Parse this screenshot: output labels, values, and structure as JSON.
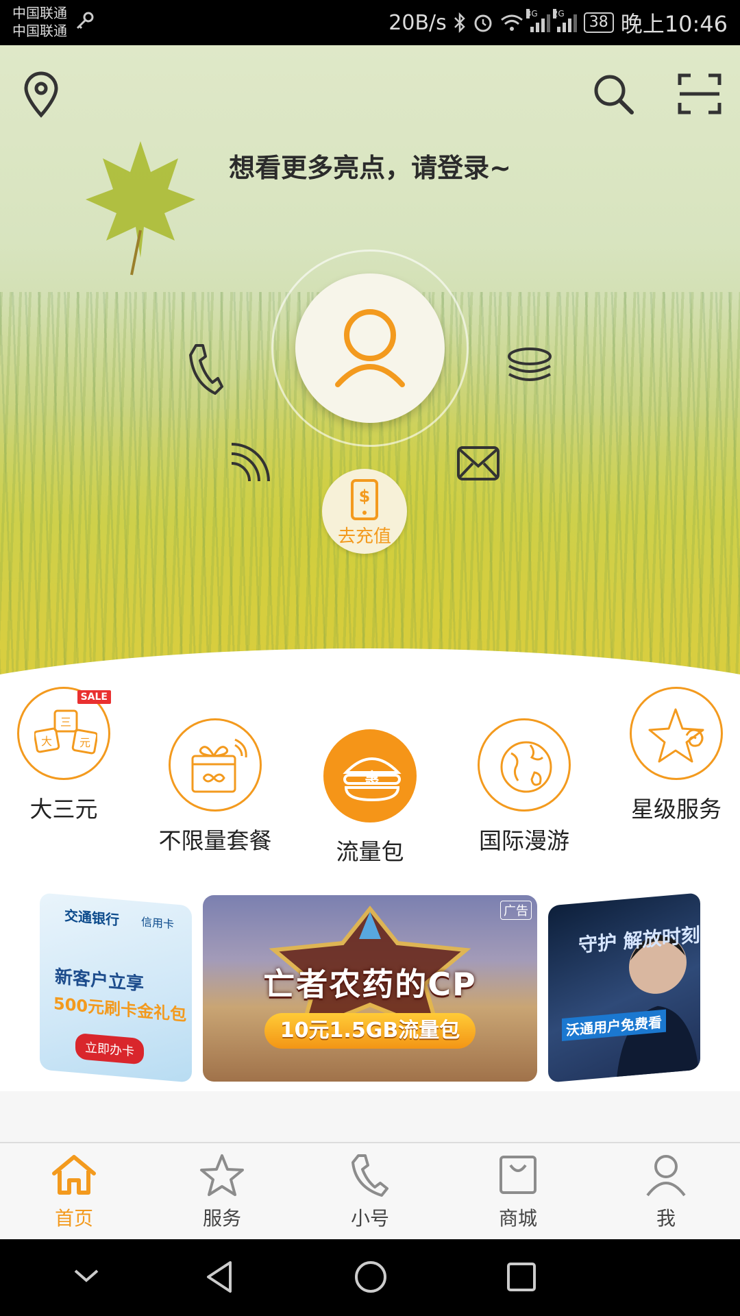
{
  "status_bar": {
    "carrier_1": "中国联通",
    "carrier_2": "中国联通",
    "net_speed": "20B/s",
    "battery": "38",
    "time": "晚上10:46",
    "signal_1_tag": "3G",
    "signal_2_tag": "2G"
  },
  "hero": {
    "login_prompt": "想看更多亮点，请登录~",
    "recharge_label": "去充值"
  },
  "shortcuts": [
    {
      "label": "大三元",
      "badge": "SALE",
      "icon": "dice-icon"
    },
    {
      "label": "不限量套餐",
      "icon": "gift-infinity-icon"
    },
    {
      "label": "流量包",
      "icon": "hui-burger-icon"
    },
    {
      "label": "国际漫游",
      "icon": "globe-icon"
    },
    {
      "label": "星级服务",
      "icon": "star-icon"
    }
  ],
  "banners": {
    "left": {
      "bank_name": "交通银行",
      "bank_tag": "信用卡",
      "promo_line1": "新客户立享",
      "promo_line2": "500元刷卡金礼包",
      "cta": "立即办卡"
    },
    "center": {
      "ad_tag": "广告",
      "title": "亡者农药的CP",
      "subtitle": "10元1.5GB流量包"
    },
    "right": {
      "title": "守护 解放时刻",
      "subtitle": "沃通用户免费看"
    }
  },
  "bottom_nav": [
    {
      "label": "首页",
      "active": true
    },
    {
      "label": "服务",
      "active": false
    },
    {
      "label": "小号",
      "active": false
    },
    {
      "label": "商城",
      "active": false
    },
    {
      "label": "我",
      "active": false
    }
  ],
  "colors": {
    "accent": "#f39a1e",
    "status_bar": "#000000",
    "nav_background": "#f7f7f7"
  }
}
